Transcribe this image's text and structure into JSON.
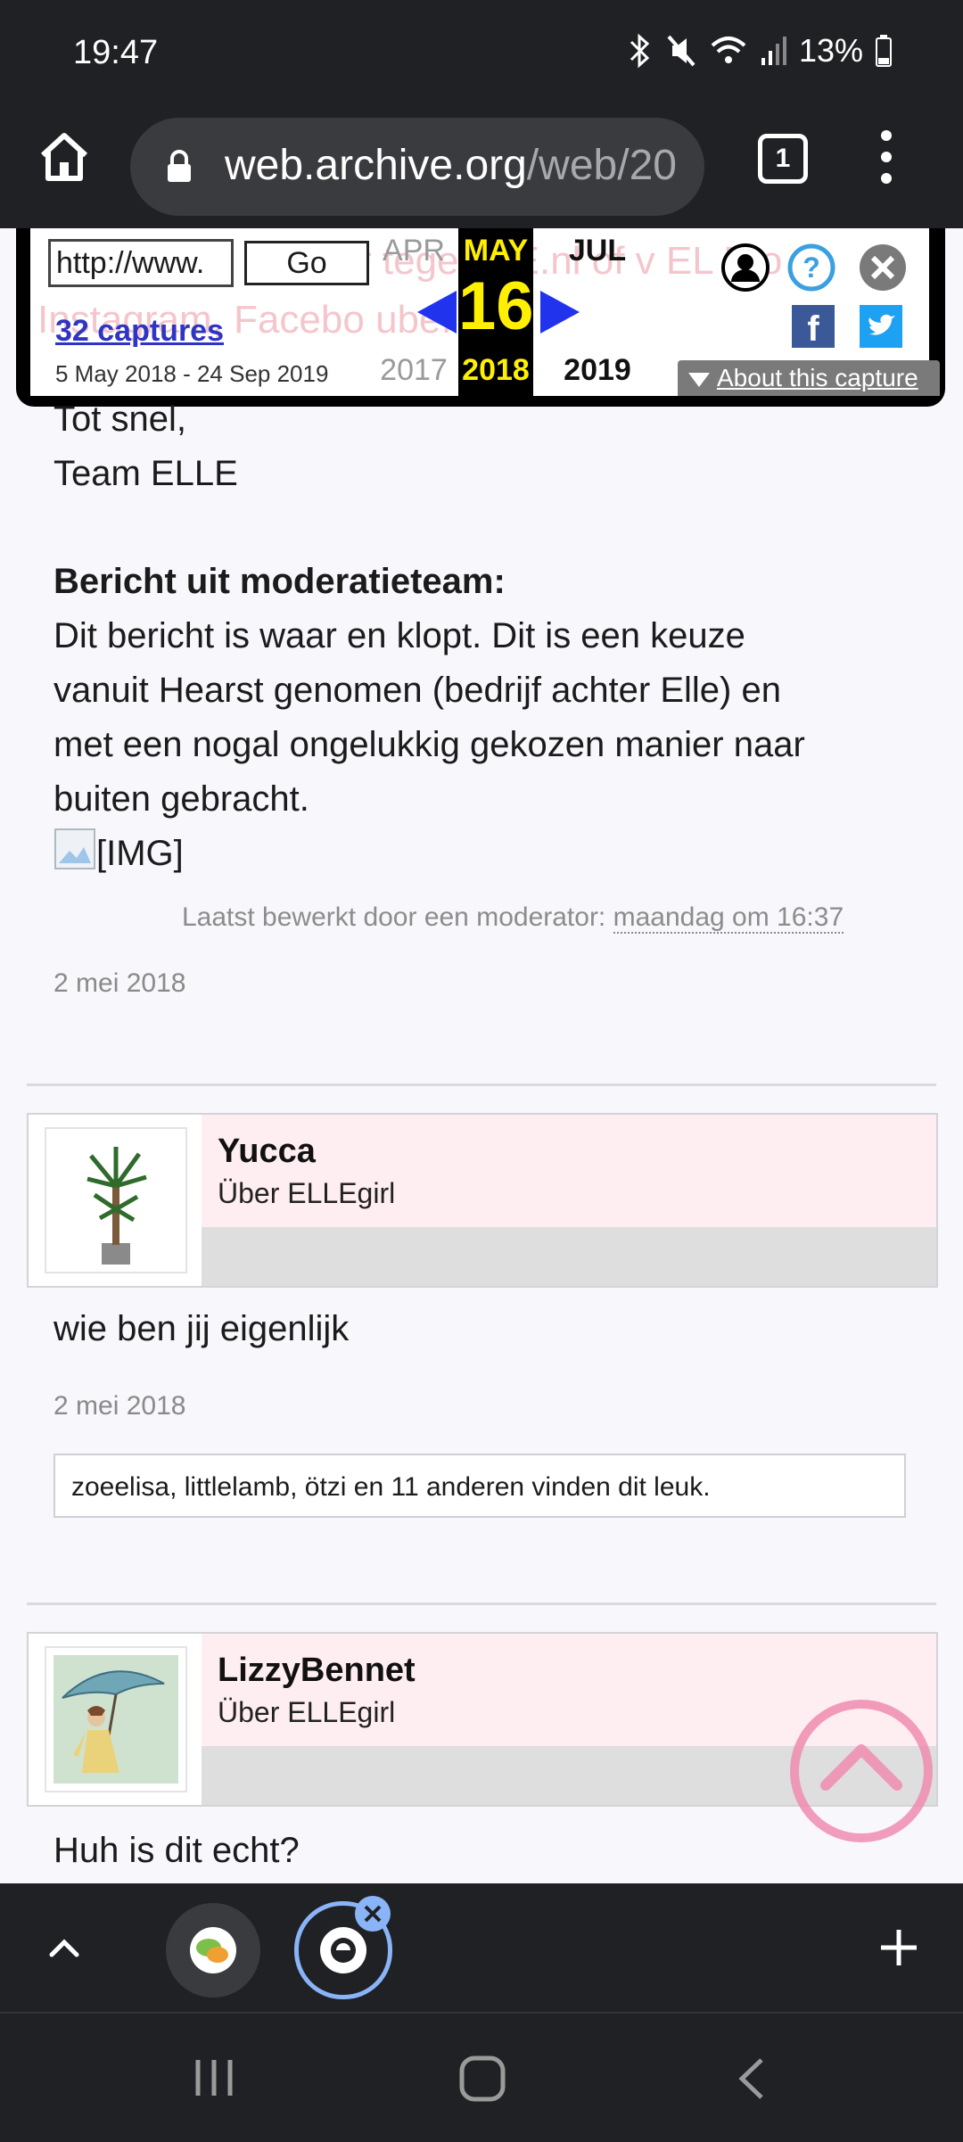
{
  "status_bar": {
    "time": "19:47",
    "battery": "13%",
    "icons": [
      "bluetooth-icon",
      "mute-icon",
      "wifi-icon",
      "signal-icon",
      "battery-icon"
    ]
  },
  "browser": {
    "url_host": "web.archive.org",
    "url_path": "/web/20",
    "tab_count": "1"
  },
  "wayback": {
    "url_input_value": "http://www.",
    "go_label": "Go",
    "captures_label": "32 captures",
    "capture_range": "5 May 2018 - 24 Sep 2019",
    "ghost_line1": "r tege    LLE.nl of v   EL  E  o",
    "ghost_line2": "Instagram, Facebo          ube.",
    "prev": {
      "month": "APR",
      "year": "2017"
    },
    "current": {
      "month": "MAY",
      "day": "16",
      "year": "2018"
    },
    "next": {
      "month": "JUL",
      "year": "2019"
    },
    "about_label": "About this capture",
    "colors": {
      "captures_link": "#2e35c4",
      "current_highlight": "#ffef00",
      "arrows": "#2233ee"
    }
  },
  "post1": {
    "line1": "Tot snel,",
    "line2": "Team ELLE",
    "moderator_heading": "Bericht uit moderatieteam:",
    "moderator_lines": [
      "Dit bericht is waar en klopt. Dit is een keuze",
      "vanuit Hearst genomen (bedrijf achter Elle) en",
      "met een nogal ongelukkig gekozen manier naar",
      "buiten gebracht."
    ],
    "img_alt": "[IMG]",
    "edited_prefix": "Laatst bewerkt door een moderator: ",
    "edited_time": "maandag om 16:37",
    "date": "2 mei 2018"
  },
  "post2": {
    "username": "Yucca",
    "role": "Über ELLEgirl",
    "text": "wie ben jij eigenlijk",
    "date": "2 mei 2018",
    "likes": "zoeelisa, littlelamb, ötzi en 11 anderen vinden dit leuk."
  },
  "post3": {
    "username": "LizzyBennet",
    "role": "Über ELLEgirl",
    "text": "Huh is dit echt?"
  }
}
